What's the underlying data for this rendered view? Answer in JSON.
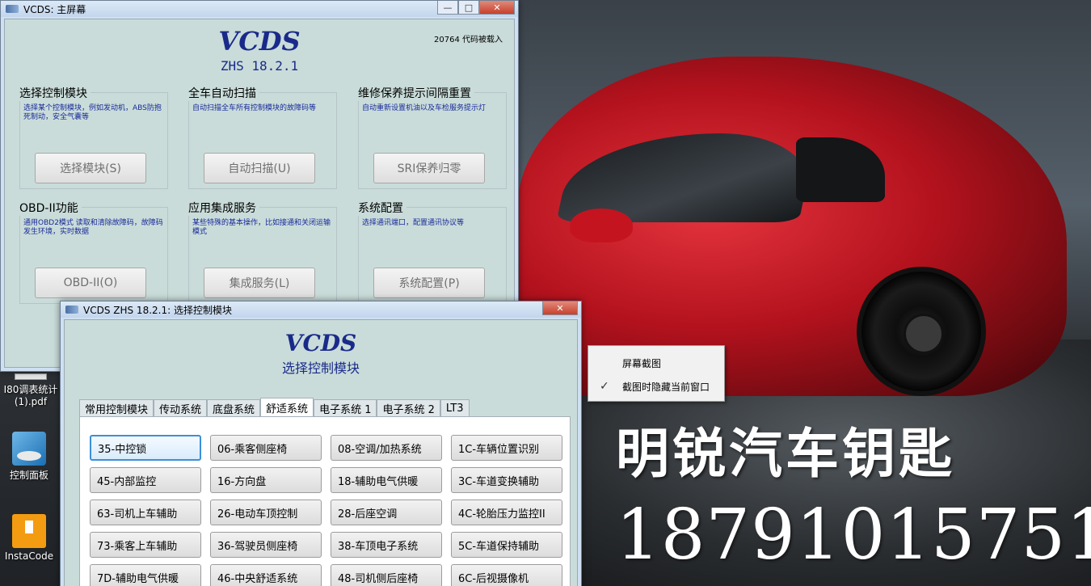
{
  "desktop": {
    "wallpaper_text_1": "明锐汽车钥匙",
    "wallpaper_text_2": "18791015751",
    "icons": [
      {
        "label": "I80调表统计(1).pdf",
        "icon": "pdf-file-icon"
      },
      {
        "label": "控制面板",
        "icon": "control-panel-icon"
      },
      {
        "label": "InstaCode",
        "icon": "instacode-icon"
      }
    ]
  },
  "main_window": {
    "title": "VCDS: 主屏幕",
    "controls": {
      "minimize": "—",
      "maximize": "□",
      "close": "✕"
    },
    "brand": "VCDS",
    "version": "ZHS 18.2.1",
    "codes_loaded": "20764 代码被载入",
    "groups": [
      {
        "title": "选择控制模块",
        "desc": "选择某个控制模块，例如发动机，ABS防抱死制动，安全气囊等",
        "button": "选择模块(S)"
      },
      {
        "title": "全车自动扫描",
        "desc": "自动扫描全车所有控制模块的故障码等",
        "button": "自动扫描(U)"
      },
      {
        "title": "维修保养提示间隔重置",
        "desc": "自动重新设置机油以及车检服务提示灯",
        "button": "SRI保养归零"
      },
      {
        "title": "OBD-II功能",
        "desc": "通用OBD2模式 读取和清除故障码，故障码发生环境，实时数据",
        "button": "OBD-II(O)"
      },
      {
        "title": "应用集成服务",
        "desc": "某些特殊的基本操作，比如接通和关闭运输模式",
        "button": "集成服务(L)"
      },
      {
        "title": "系统配置",
        "desc": "选择通讯端口，配置通讯协议等",
        "button": "系统配置(P)"
      }
    ]
  },
  "module_window": {
    "title": "VCDS ZHS 18.2.1:  选择控制模块",
    "close": "✕",
    "brand": "VCDS",
    "subtitle": "选择控制模块",
    "tabs": [
      "常用控制模块",
      "传动系统",
      "底盘系统",
      "舒适系统",
      "电子系统 1",
      "电子系统 2",
      "LT3"
    ],
    "active_tab": "舒适系统",
    "modules": [
      [
        "35-中控锁",
        "06-乘客侧座椅",
        "08-空调/加热系统",
        "1C-车辆位置识别"
      ],
      [
        "45-内部监控",
        "16-方向盘",
        "18-辅助电气供暖",
        "3C-车道变换辅助"
      ],
      [
        "63-司机上车辅助",
        "26-电动车顶控制",
        "28-后座空调",
        "4C-轮胎压力监控II"
      ],
      [
        "73-乘客上车辅助",
        "36-驾驶员侧座椅",
        "38-车顶电子系统",
        "5C-车道保持辅助"
      ],
      [
        "7D-辅助电气供暖",
        "46-中央舒适系统",
        "48-司机侧后座椅",
        "6C-后视摄像机"
      ]
    ]
  },
  "context_menu": {
    "items": [
      {
        "label": "屏幕截图",
        "checked": false
      },
      {
        "label": "截图时隐藏当前窗口",
        "checked": true
      }
    ]
  }
}
